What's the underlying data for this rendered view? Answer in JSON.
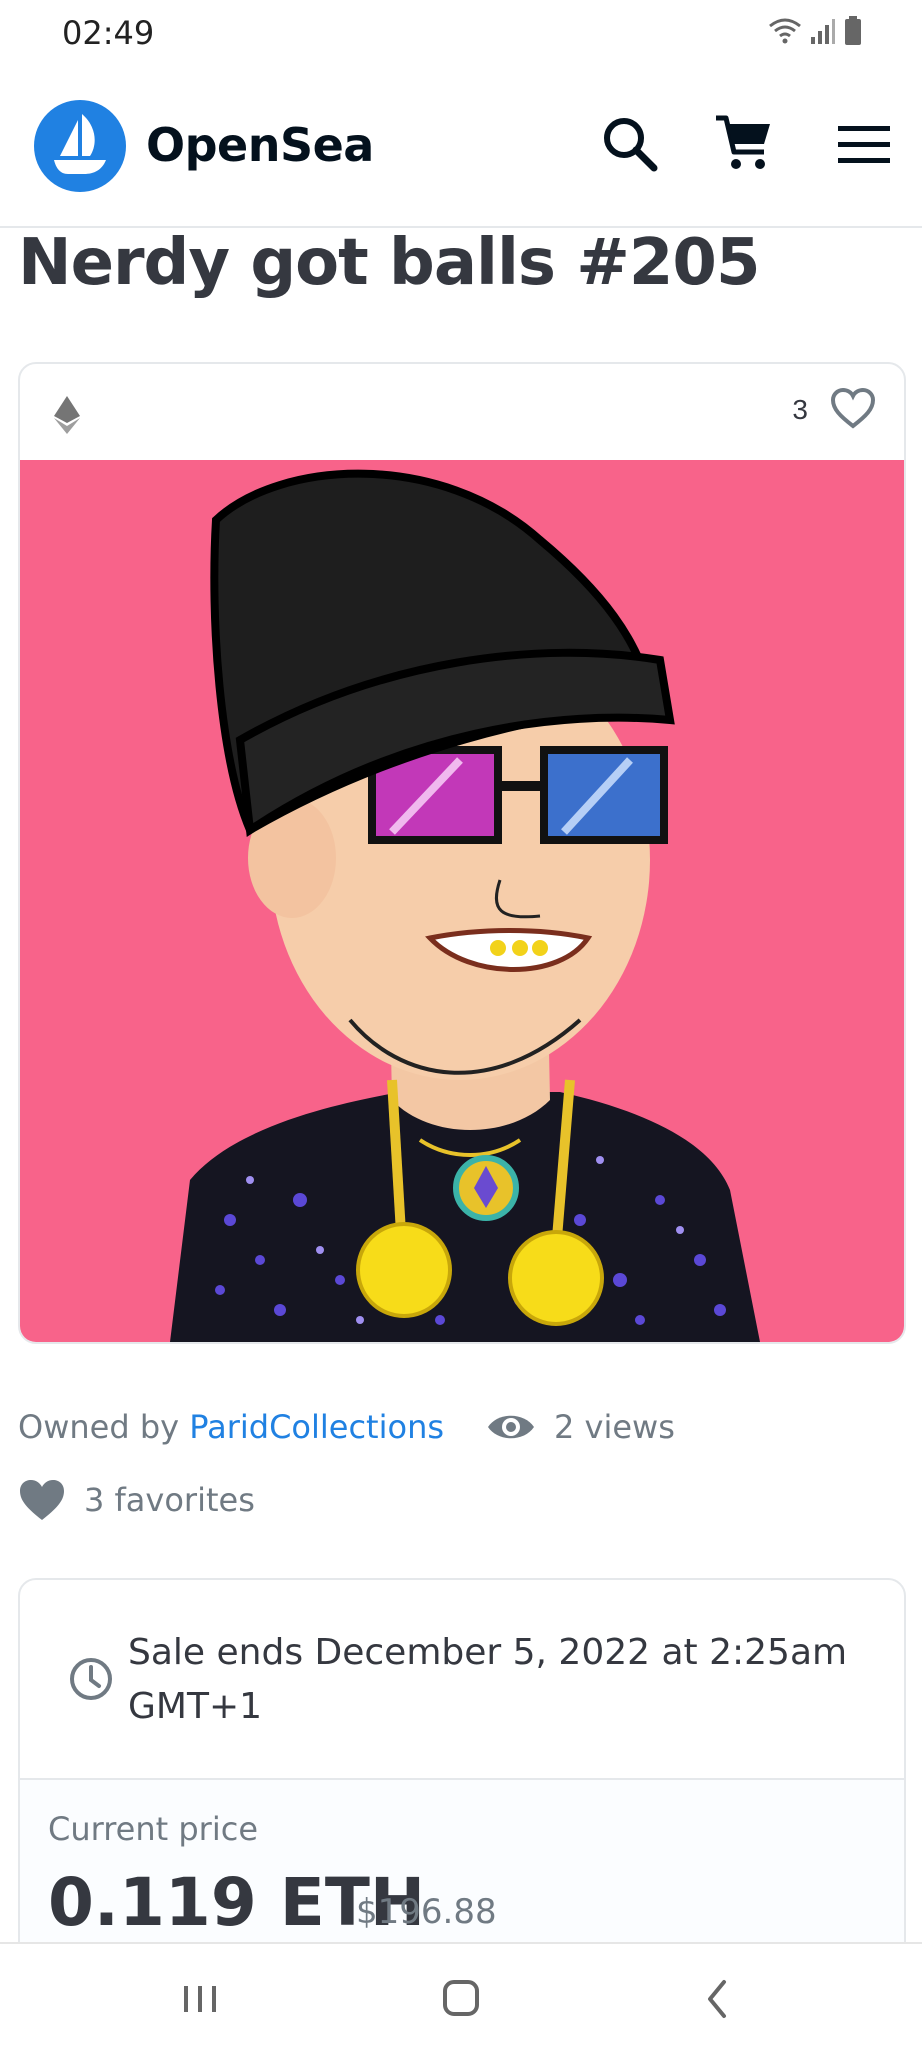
{
  "status": {
    "time": "02:49"
  },
  "header": {
    "brand": "OpenSea"
  },
  "item": {
    "title": "Nerdy got balls #205",
    "favorite_count": "3",
    "owned_by_label": "Owned by",
    "owner": "ParidCollections",
    "views": "2 views",
    "favorites": "3 favorites"
  },
  "sale": {
    "ends_text": "Sale ends December 5, 2022 at 2:25am GMT+1",
    "current_price_label": "Current price",
    "price": "0.119 ETH",
    "price_usd": "$196.88"
  },
  "colors": {
    "accent": "#2081e2",
    "text": "#353840",
    "muted": "#707a83",
    "art_background": "#f8638a"
  },
  "icons": [
    "wifi-icon",
    "signal-icon",
    "battery-icon",
    "opensea-logo-icon",
    "search-icon",
    "cart-icon",
    "menu-icon",
    "ethereum-icon",
    "heart-outline-icon",
    "eye-icon",
    "heart-filled-icon",
    "clock-icon",
    "recent-apps-icon",
    "home-icon",
    "back-icon"
  ]
}
